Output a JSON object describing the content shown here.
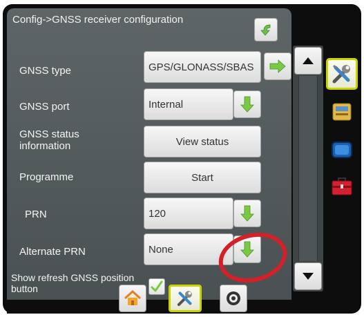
{
  "screen": {
    "title": "Config->GNSS receiver configuration"
  },
  "rows": {
    "gnss_type": {
      "label": "GNSS type",
      "value": "GPS/GLONASS/SBAS"
    },
    "gnss_port": {
      "label": "GNSS port",
      "value": "Internal"
    },
    "gnss_status": {
      "label": "GNSS status information",
      "button": "View status"
    },
    "programme": {
      "label": "Programme",
      "button": "Start"
    },
    "prn": {
      "label": "PRN",
      "value": "120"
    },
    "alternate_prn": {
      "label": "Alternate PRN",
      "value": "None"
    },
    "show_refresh": {
      "label": "Show refresh GNSS position button",
      "checked": true
    }
  },
  "icons": {
    "back": "back-arrow-icon",
    "next": "right-arrow-icon",
    "dropdown": "down-arrow-icon",
    "scroll_up": "scroll-up-icon",
    "scroll_down": "scroll-down-icon",
    "home": "home-icon",
    "tools": "tools-icon",
    "camera": "camera-icon",
    "console": "console-icon",
    "screen": "screen-icon",
    "toolbox": "toolbox-icon"
  },
  "colors": {
    "accent_green": "#7ac943",
    "highlight_red": "#d42028",
    "active_border": "#c8d400"
  }
}
